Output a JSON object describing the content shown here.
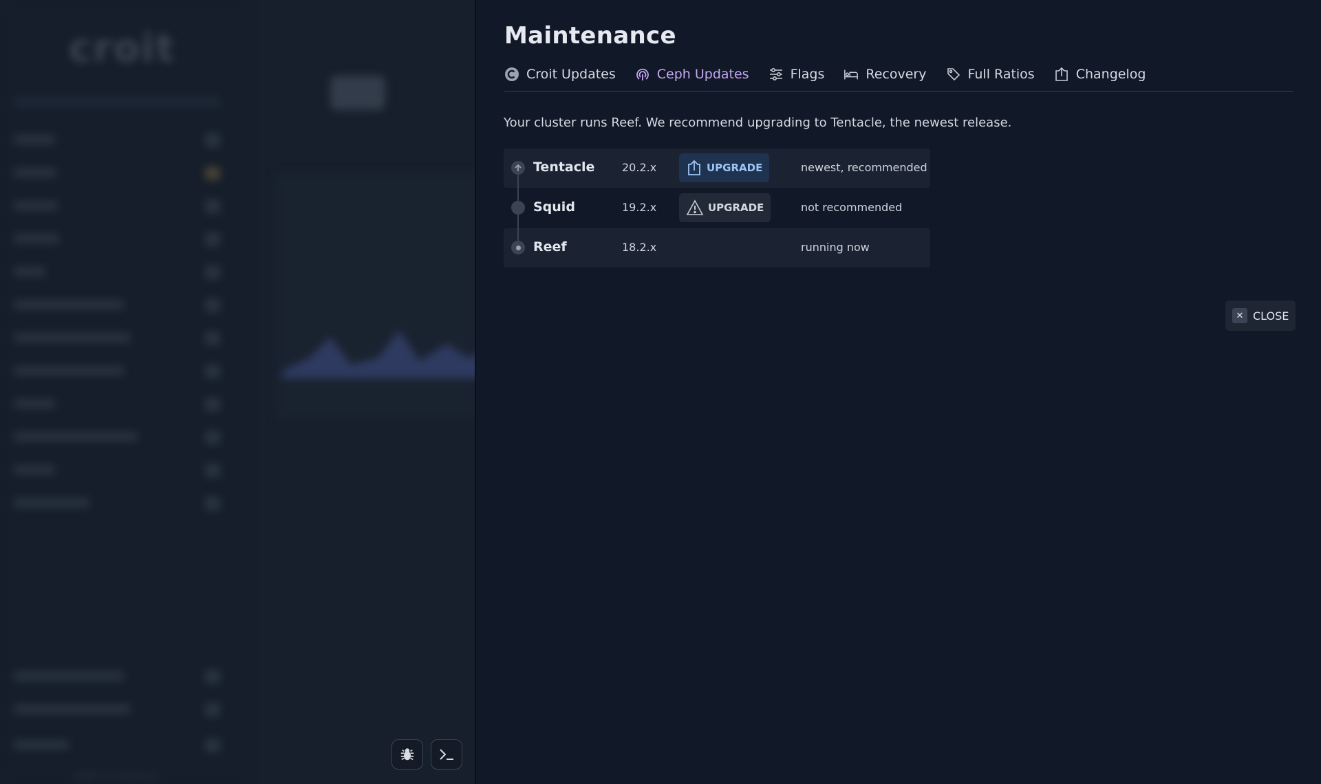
{
  "panel": {
    "title": "Maintenance",
    "tabs": [
      {
        "label": "Croit Updates",
        "icon": "croit-logo-icon",
        "active": false
      },
      {
        "label": "Ceph Updates",
        "icon": "ceph-logo-icon",
        "active": true
      },
      {
        "label": "Flags",
        "icon": "sliders-icon",
        "active": false
      },
      {
        "label": "Recovery",
        "icon": "recovery-bed-icon",
        "active": false
      },
      {
        "label": "Full Ratios",
        "icon": "tag-icon",
        "active": false
      },
      {
        "label": "Changelog",
        "icon": "upload-box-icon",
        "active": false
      }
    ],
    "intro": "Your cluster runs Reef. We recommend upgrading to Tentacle, the newest release.",
    "releases": [
      {
        "name": "Tentacle",
        "version": "20.2.x",
        "action": "UPGRADE",
        "action_icon": "upload-icon",
        "note": "newest, recommended"
      },
      {
        "name": "Squid",
        "version": "19.2.x",
        "action": "UPGRADE",
        "action_icon": "warning-icon",
        "note": "not recommended"
      },
      {
        "name": "Reef",
        "version": "18.2.x",
        "action": "",
        "note": "running now"
      }
    ],
    "close_label": "CLOSE"
  },
  "background": {
    "logo": "croit",
    "version": "v2507.0.tentacle"
  },
  "colors": {
    "active_tab": "#c4a8f0",
    "primary_button_text": "#9ec4f5",
    "panel_bg": "#111827"
  }
}
